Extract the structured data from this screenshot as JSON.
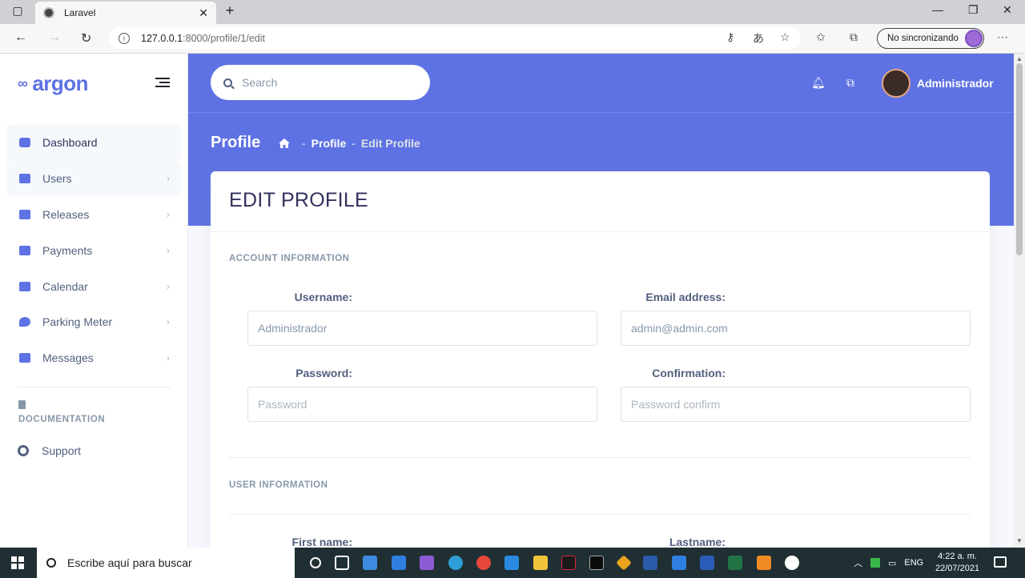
{
  "browser": {
    "tab_title": "Laravel",
    "url_host": "127.0.0.1",
    "url_path": ":8000/profile/1/edit",
    "sync_label": "No sincronizando"
  },
  "sidebar": {
    "brand": "argon",
    "items": [
      {
        "label": "Dashboard",
        "color": "#5e72e4"
      },
      {
        "label": "Users",
        "color": "#5e72e4"
      },
      {
        "label": "Releases",
        "color": "#5e72e4"
      },
      {
        "label": "Payments",
        "color": "#5e72e4"
      },
      {
        "label": "Calendar",
        "color": "#5e72e4"
      },
      {
        "label": "Parking Meter",
        "color": "#5e72e4"
      },
      {
        "label": "Messages",
        "color": "#5e72e4"
      }
    ],
    "doc_heading": "DOCUMENTATION",
    "support": "Support"
  },
  "header": {
    "search_placeholder": "Search",
    "user_name": "Administrador"
  },
  "page": {
    "title": "Profile",
    "breadcrumb": [
      "Profile",
      "Edit Profile"
    ]
  },
  "card": {
    "title": "EDIT PROFILE",
    "account_section": "ACCOUNT INFORMATION",
    "user_section": "USER INFORMATION",
    "username_label": "Username:",
    "username_value": "Administrador",
    "email_label": "Email address:",
    "email_value": "admin@admin.com",
    "password_label": "Password:",
    "password_placeholder": "Password",
    "confirm_label": "Confirmation:",
    "confirm_placeholder": "Password confirm",
    "firstname_label": "First name:",
    "lastname_label": "Lastname:"
  },
  "taskbar": {
    "search_placeholder": "Escribe aquí para buscar",
    "lang": "ENG",
    "time": "4:22 a. m.",
    "date": "22/07/2021"
  },
  "colors": {
    "primary": "#5e72e4"
  }
}
